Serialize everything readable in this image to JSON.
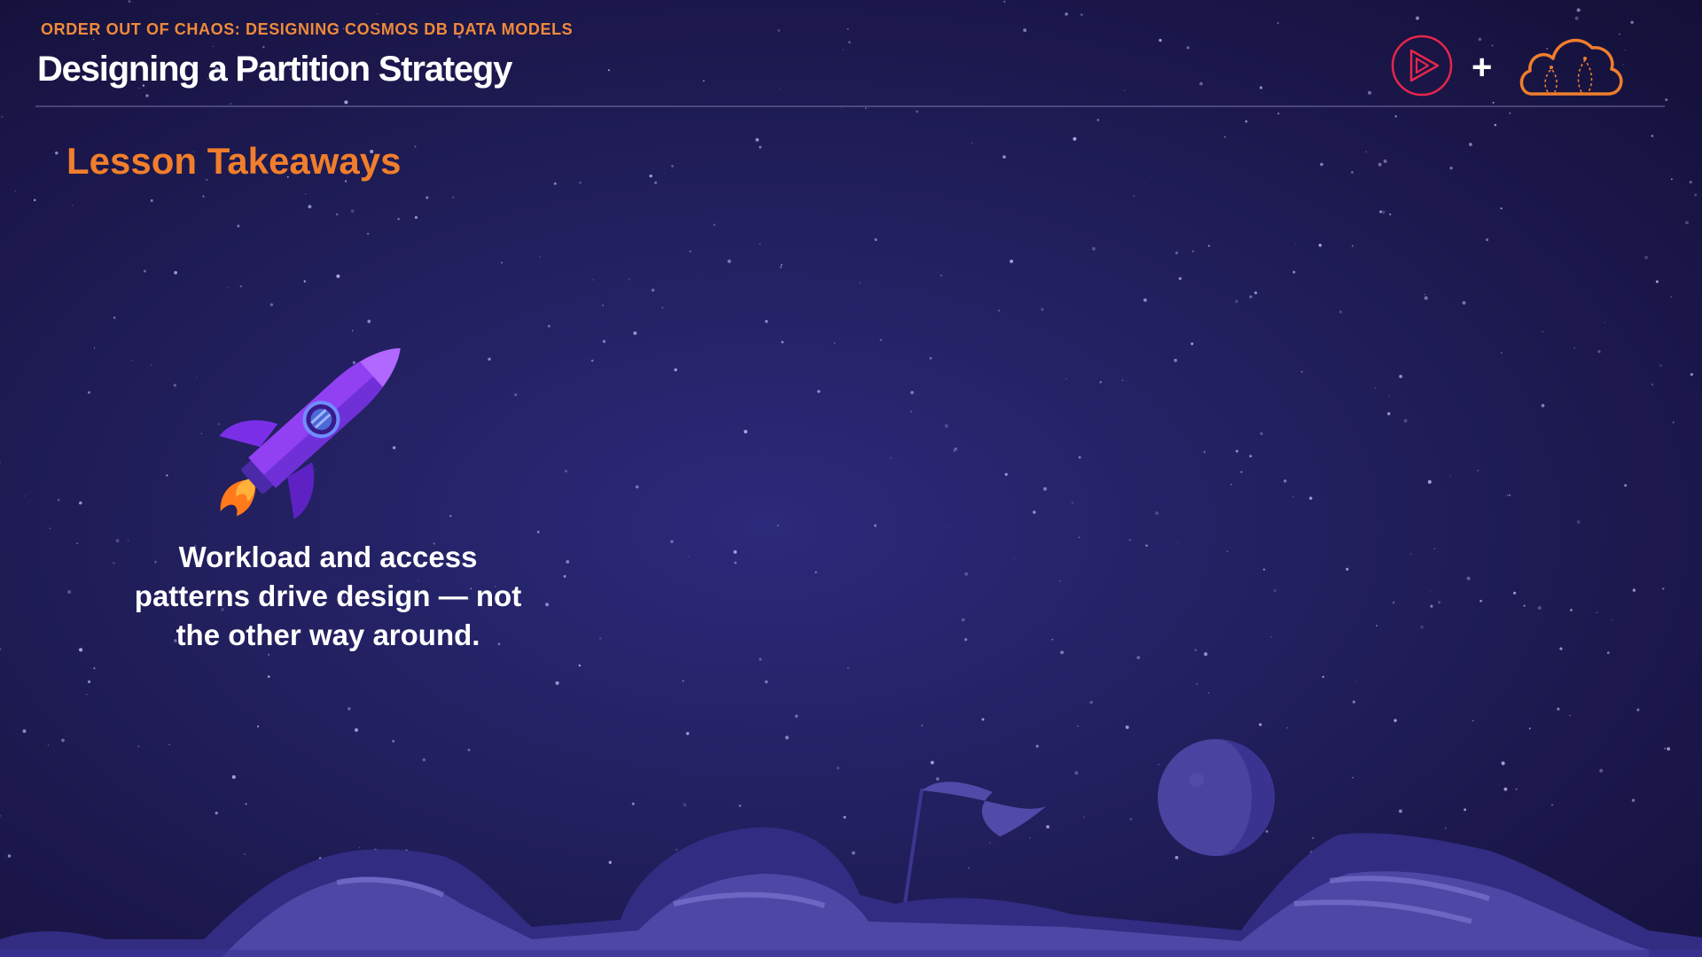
{
  "header": {
    "eyebrow": "ORDER OUT OF CHAOS: DESIGNING COSMOS DB DATA MODELS",
    "title": "Designing a Partition Strategy",
    "plus": "+"
  },
  "section": {
    "title": "Lesson Takeaways"
  },
  "takeaway": {
    "line1": "Workload and access",
    "line2": "patterns drive design — not",
    "line3": "the other way around."
  },
  "icons": [
    "play-logo-icon",
    "cloud-logo-icon",
    "rocket-icon",
    "flag-icon",
    "planet-icon"
  ],
  "colors": {
    "accent": "#f07e2c",
    "background": "#221f5e",
    "logo_red": "#e6264b"
  }
}
